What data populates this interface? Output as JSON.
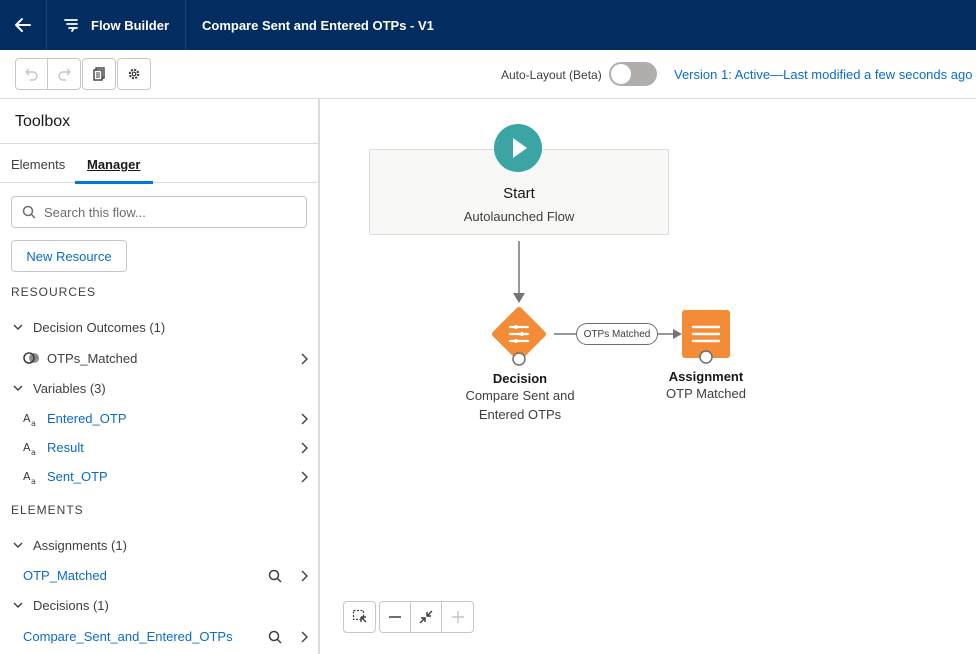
{
  "header": {
    "app_name": "Flow Builder",
    "flow_title": "Compare Sent and Entered OTPs - V1"
  },
  "toolbar": {
    "auto_layout_label": "Auto-Layout (Beta)",
    "auto_layout_on": false,
    "version_status": "Version 1: Active—Last modified a few seconds ago"
  },
  "sidebar": {
    "title": "Toolbox",
    "tabs": [
      {
        "label": "Elements",
        "active": false
      },
      {
        "label": "Manager",
        "active": true
      }
    ],
    "search_placeholder": "Search this flow...",
    "new_resource_label": "New Resource",
    "resources_heading": "RESOURCES",
    "resources": [
      {
        "group": "Decision Outcomes (1)",
        "items": [
          "OTPs_Matched"
        ]
      },
      {
        "group": "Variables (3)",
        "items": [
          "Entered_OTP",
          "Result",
          "Sent_OTP"
        ]
      }
    ],
    "elements_heading": "ELEMENTS",
    "elements": [
      {
        "group": "Assignments (1)",
        "items": [
          "OTP_Matched"
        ]
      },
      {
        "group": "Decisions (1)",
        "items": [
          "Compare_Sent_and_Entered_OTPs"
        ]
      }
    ]
  },
  "canvas": {
    "start": {
      "title": "Start",
      "subtitle": "Autolaunched Flow",
      "color": "#3ba5a3"
    },
    "decision": {
      "type": "Decision",
      "label_line1": "Compare Sent and",
      "label_line2": "Entered OTPs",
      "color": "#f38b37"
    },
    "connector_label": "OTPs Matched",
    "assignment": {
      "type": "Assignment",
      "label": "OTP Matched",
      "color": "#f38b37"
    }
  },
  "colors": {
    "header_bg": "#032d60",
    "link": "#0b6bcb",
    "brand": "#0176d3"
  }
}
